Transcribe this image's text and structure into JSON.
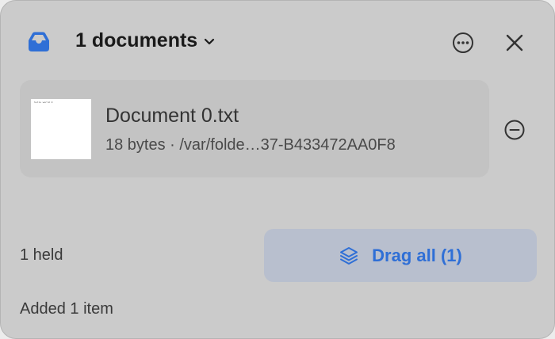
{
  "header": {
    "title": "1 documents",
    "title_icon": "chevron-down-icon",
    "tray_icon": "tray-icon",
    "more_icon": "ellipsis-circle-icon",
    "close_icon": "close-icon"
  },
  "documents": [
    {
      "name": "Document 0.txt",
      "meta": "18 bytes · /var/folde…37-B433472AA0F8",
      "thumbnail_text": "hello world 0",
      "remove_icon": "minus-circle-icon"
    }
  ],
  "footer": {
    "held_label": "1 held",
    "drag_button_label": "Drag all (1)",
    "drag_icon": "stack-icon",
    "status_text": "Added 1 item"
  },
  "colors": {
    "accent": "#2f6fd6",
    "panel_bg": "#cbcbcb",
    "card_bg": "#c3c3c3",
    "drag_button_bg": "#b8bfce"
  }
}
